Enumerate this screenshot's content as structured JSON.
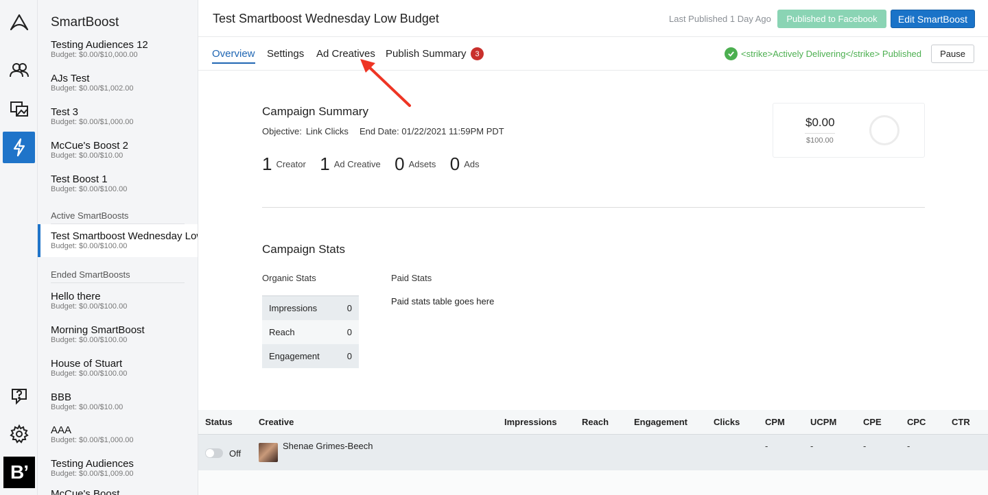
{
  "sidebar": {
    "title": "SmartBoost",
    "top_items": [
      {
        "name": "Testing Audiences 12",
        "budget": "Budget: $0.00/$10,000.00"
      },
      {
        "name": "AJs Test",
        "budget": "Budget: $0.00/$1,002.00"
      },
      {
        "name": "Test 3",
        "budget": "Budget: $0.00/$1,000.00"
      },
      {
        "name": "McCue's Boost 2",
        "budget": "Budget: $0.00/$10.00"
      },
      {
        "name": "Test Boost 1",
        "budget": "Budget: $0.00/$100.00"
      }
    ],
    "active_section": "Active SmartBoosts",
    "active_items": [
      {
        "name": "Test Smartboost Wednesday Low Budget",
        "budget": "Budget: $0.00/$100.00"
      }
    ],
    "ended_section": "Ended SmartBoosts",
    "ended_items": [
      {
        "name": "Hello there",
        "budget": "Budget: $0.00/$100.00"
      },
      {
        "name": "Morning SmartBoost",
        "budget": "Budget: $0.00/$100.00"
      },
      {
        "name": "House of Stuart",
        "budget": "Budget: $0.00/$100.00"
      },
      {
        "name": "BBB",
        "budget": "Budget: $0.00/$10.00"
      },
      {
        "name": "AAA",
        "budget": "Budget: $0.00/$1,000.00"
      },
      {
        "name": "Testing Audiences",
        "budget": "Budget: $0.00/$1,009.00"
      },
      {
        "name": "McCue's Boost",
        "budget": ""
      }
    ]
  },
  "rail": {
    "brand_letter": "B’"
  },
  "header": {
    "title": "Test Smartboost Wednesday Low Budget",
    "last_published": "Last Published 1 Day Ago",
    "published_button": "Published to Facebook",
    "edit_button": "Edit SmartBoost"
  },
  "tabs": {
    "overview": "Overview",
    "settings": "Settings",
    "ad_creatives": "Ad Creatives",
    "publish_summary": "Publish Summary",
    "publish_badge": "3",
    "status_text": "<strike>Actively Delivering</strike> Published",
    "pause_button": "Pause"
  },
  "summary": {
    "title": "Campaign Summary",
    "objective_label": "Objective:",
    "objective_value": "Link Clicks",
    "end_date": "End Date: 01/22/2021 11:59PM PDT",
    "counts": [
      {
        "num": "1",
        "label": "Creator"
      },
      {
        "num": "1",
        "label": "Ad Creative"
      },
      {
        "num": "0",
        "label": "Adsets"
      },
      {
        "num": "0",
        "label": "Ads"
      }
    ],
    "budget_spent": "$0.00",
    "budget_total": "$100.00"
  },
  "stats": {
    "title": "Campaign Stats",
    "organic_label": "Organic Stats",
    "paid_label": "Paid Stats",
    "paid_note": "Paid stats table goes here",
    "organic_rows": [
      {
        "label": "Impressions",
        "value": "0"
      },
      {
        "label": "Reach",
        "value": "0"
      },
      {
        "label": "Engagement",
        "value": "0"
      }
    ]
  },
  "table": {
    "headers": {
      "status": "Status",
      "creative": "Creative",
      "impressions": "Impressions",
      "reach": "Reach",
      "engagement": "Engagement",
      "clicks": "Clicks",
      "cpm": "CPM",
      "ucpm": "UCPM",
      "cpe": "CPE",
      "cpc": "CPC",
      "ctr": "CTR"
    },
    "rows": [
      {
        "status": "Off",
        "creator": "Shenae Grimes-Beech",
        "cpm": "-",
        "ucpm": "-",
        "cpe": "-",
        "cpc": "-"
      }
    ]
  },
  "colors": {
    "accent": "#1f74c9",
    "published_green": "#4caf50",
    "badge_red": "#c9302c",
    "annotation_arrow": "#ee3524"
  }
}
